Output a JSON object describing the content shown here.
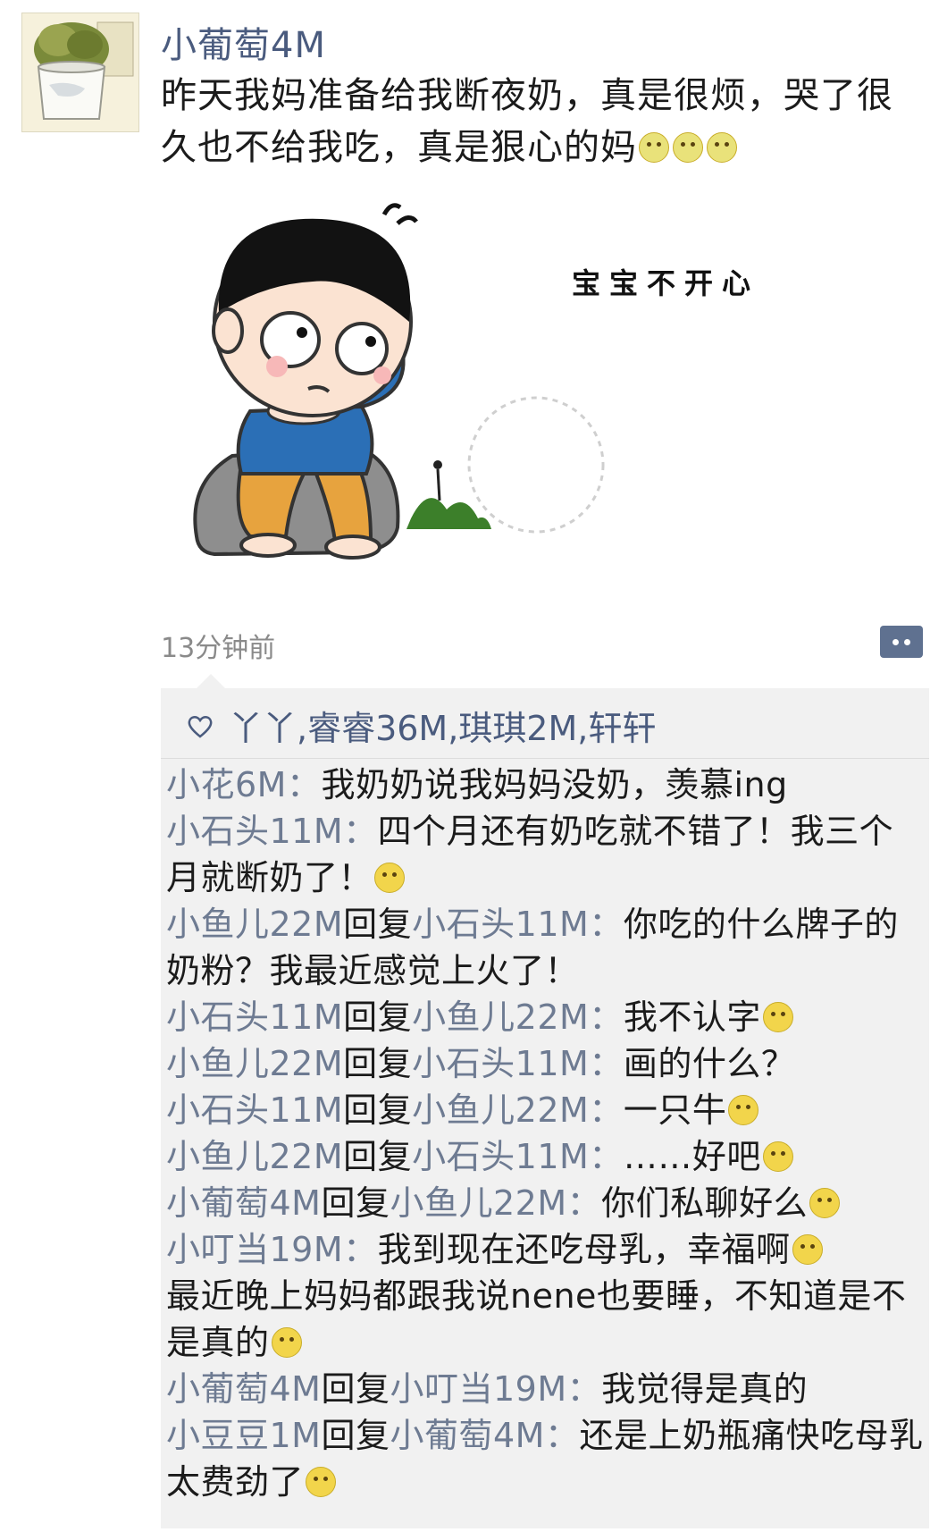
{
  "post": {
    "author": "小葡萄4M",
    "text": "昨天我妈准备给我断夜奶，真是很烦，哭了很久也不给我吃，真是狠心的妈",
    "trailing_emojis": [
      "cry-emoji",
      "cry-emoji",
      "cry-emoji"
    ],
    "sticker_caption": "宝宝不开心",
    "time": "13分钟前"
  },
  "likes": {
    "names": "丫丫,睿睿36M,琪琪2M,轩轩"
  },
  "comments": [
    {
      "name": "小花6M",
      "reply_word": "",
      "reply_to": "",
      "text": "我奶奶说我妈妈没奶，羡慕ing",
      "emoji": ""
    },
    {
      "name": "小石头11M",
      "reply_word": "",
      "reply_to": "",
      "text": "四个月还有奶吃就不错了！我三个月就断奶了！",
      "emoji": "cry-emoji"
    },
    {
      "name": "小鱼儿22M",
      "reply_word": "回复",
      "reply_to": "小石头11M",
      "text": "你吃的什么牌子的奶粉？我最近感觉上火了！",
      "emoji": ""
    },
    {
      "name": "小石头11M",
      "reply_word": "回复",
      "reply_to": "小鱼儿22M",
      "text": "我不认字",
      "emoji": "grin-emoji"
    },
    {
      "name": "小鱼儿22M",
      "reply_word": "回复",
      "reply_to": "小石头11M",
      "text": "画的什么？",
      "emoji": ""
    },
    {
      "name": "小石头11M",
      "reply_word": "回复",
      "reply_to": "小鱼儿22M",
      "text": "一只牛",
      "emoji": "smile-emoji"
    },
    {
      "name": "小鱼儿22M",
      "reply_word": "回复",
      "reply_to": "小石头11M",
      "text": "……好吧",
      "emoji": "grin-emoji"
    },
    {
      "name": "小葡萄4M",
      "reply_word": "回复",
      "reply_to": "小鱼儿22M",
      "text": "你们私聊好么",
      "emoji": "shy-emoji"
    },
    {
      "name": "小叮当19M",
      "reply_word": "",
      "reply_to": "",
      "text": "我到现在还吃母乳，幸福啊",
      "emoji": "smile-emoji"
    },
    {
      "name": "",
      "reply_word": "",
      "reply_to": "",
      "text": "最近晚上妈妈都跟我说nene也要睡，不知道是不是真的",
      "emoji": "grin-emoji"
    },
    {
      "name": "小葡萄4M",
      "reply_word": "回复",
      "reply_to": "小叮当19M",
      "text": "我觉得是真的",
      "emoji": ""
    },
    {
      "name": "小豆豆1M",
      "reply_word": "回复",
      "reply_to": "小葡萄4M",
      "text": "还是上奶瓶痛快吃母乳太费劲了",
      "emoji": "laugh-emoji"
    }
  ],
  "colors": {
    "name_link": "#4a5b7e",
    "comment_bg": "#f1f1f1",
    "timestamp": "#8a8a8a"
  }
}
